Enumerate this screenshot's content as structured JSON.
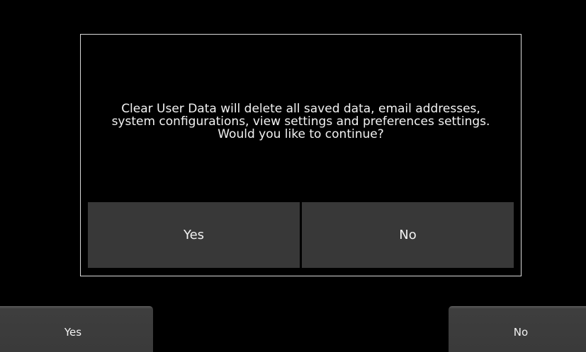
{
  "dialog": {
    "message": "Clear User Data will delete all saved data, email addresses,\nsystem configurations, view settings and preferences settings.\nWould you like to continue?",
    "yes_label": "Yes",
    "no_label": "No"
  },
  "softkeys": {
    "left_label": "Yes",
    "right_label": "No"
  },
  "colors": {
    "background": "#000000",
    "button": "#383838",
    "border": "#d9d9d9",
    "text": "#f2f2f2"
  }
}
